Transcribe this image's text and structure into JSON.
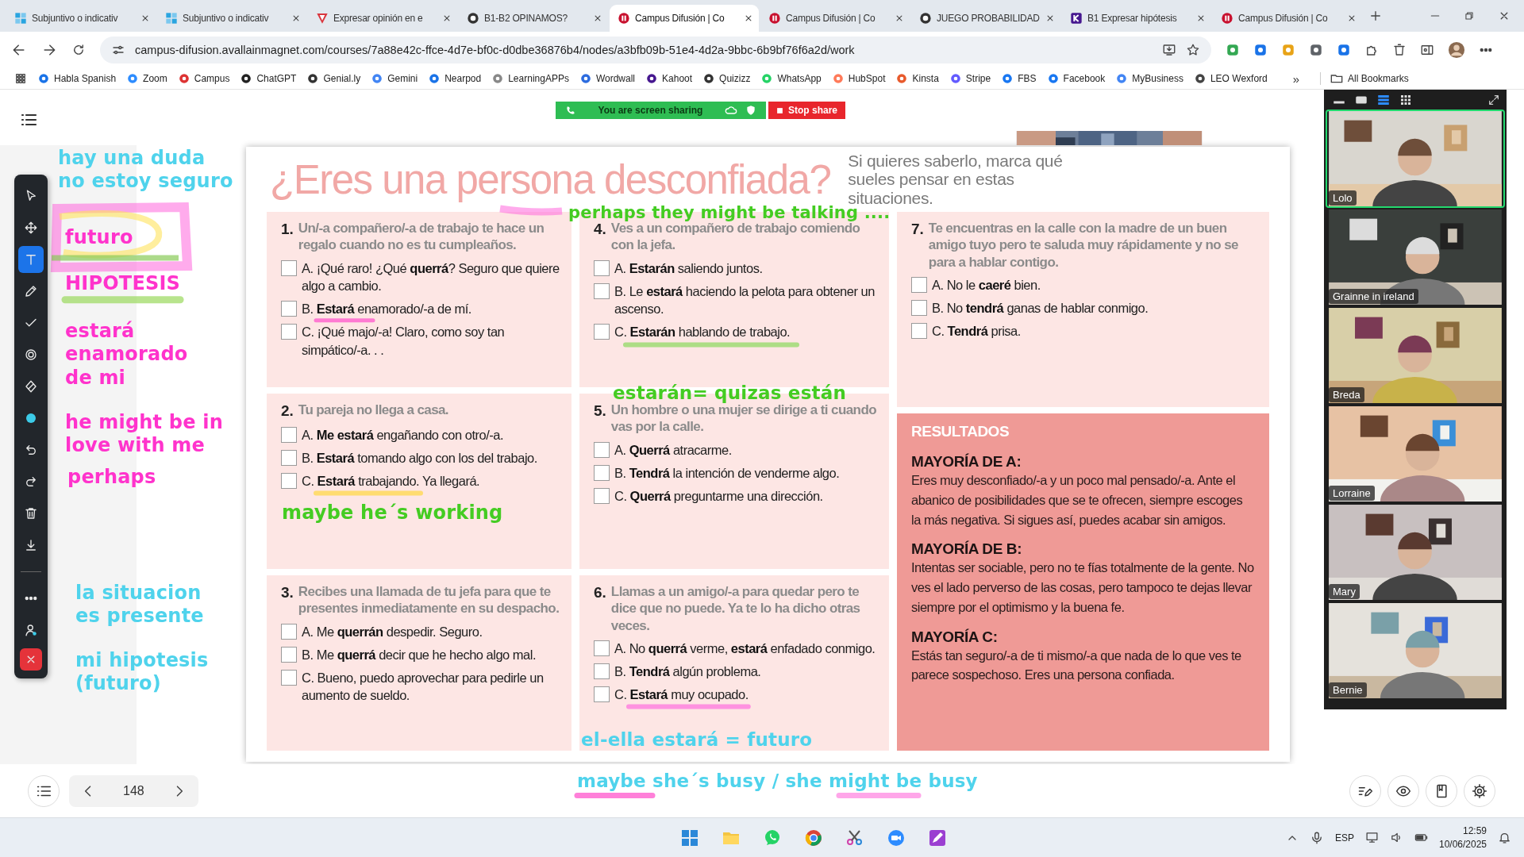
{
  "tabs": [
    {
      "title": "Subjuntivo o indicativ",
      "selected": false
    },
    {
      "title": "Subjuntivo o indicativ",
      "selected": false
    },
    {
      "title": "Expresar opinión en e",
      "selected": false
    },
    {
      "title": "B1-B2 OPINAMOS?",
      "selected": false
    },
    {
      "title": "Campus Difusión | Co",
      "selected": true
    },
    {
      "title": "Campus Difusión | Co",
      "selected": false
    },
    {
      "title": "JUEGO PROBABILIDAD",
      "selected": false
    },
    {
      "title": "B1 Expresar hipótesis",
      "selected": false
    },
    {
      "title": "Campus Difusión | Co",
      "selected": false
    }
  ],
  "address": {
    "url": "campus-difusion.avallainmagnet.com/courses/7a88e42c-ffce-4d7e-bf0c-d0dbe36876b4/nodes/a3bfb09b-51e4-4d2a-9bbc-6b9bf76f6a2d/work"
  },
  "bookmarks": [
    "Habla Spanish",
    "Zoom",
    "Campus",
    "ChatGPT",
    "Genial.ly",
    "Gemini",
    "Nearpod",
    "LearningAPPs",
    "Wordwall",
    "Kahoot",
    "Quizizz",
    "WhatsApp",
    "HubSpot",
    "Kinsta",
    "Stripe",
    "FBS",
    "Facebook",
    "MyBusiness",
    "LEO Wexford"
  ],
  "bookmarks_more": "»",
  "all_bookmarks": "All Bookmarks",
  "share_banner": {
    "status": "You are screen sharing",
    "stop": "Stop share"
  },
  "tools": [
    {
      "kind": "pointer",
      "selected": false
    },
    {
      "kind": "move",
      "selected": false
    },
    {
      "kind": "text",
      "selected": true
    },
    {
      "kind": "pencil",
      "selected": false
    },
    {
      "kind": "check",
      "selected": false
    },
    {
      "kind": "target",
      "selected": false
    },
    {
      "kind": "eraser",
      "selected": false
    },
    {
      "kind": "color",
      "selected": false
    },
    {
      "kind": "undo",
      "selected": false
    },
    {
      "kind": "redo",
      "selected": false
    },
    {
      "kind": "trash",
      "selected": false
    },
    {
      "kind": "download",
      "selected": false
    },
    {
      "kind": "more",
      "selected": false
    },
    {
      "kind": "person",
      "selected": false
    },
    {
      "kind": "close",
      "selected": false
    }
  ],
  "document": {
    "title": "¿Eres una persona desconfiada?",
    "intro": "Si quieres saberlo, marca qué sueles pensar en estas situaciones.",
    "questions": [
      {
        "number": "1.",
        "prompt": "Un/-a compañero/-a de trabajo te hace un regalo cuando no es tu cumpleaños.",
        "options": [
          {
            "text": "A. ¡Qué raro! ¿Qué **querrá**? Seguro que quiere algo a cambio.",
            "checked": false
          },
          {
            "text": "B. **Estará** enamorado/-a de mí.",
            "checked": false
          },
          {
            "text": "C. ¡Qué majo/-a! Claro, como soy tan simpático/-a. . .",
            "checked": false
          }
        ]
      },
      {
        "number": "2.",
        "prompt": "Tu pareja no llega a casa.",
        "options": [
          {
            "text": "A. **Me estará** engañando con otro/-a.",
            "checked": false
          },
          {
            "text": "B. **Estará** tomando algo con los del trabajo.",
            "checked": false
          },
          {
            "text": "C. **Estará** trabajando. Ya llegará.",
            "checked": false
          }
        ]
      },
      {
        "number": "3.",
        "prompt": "Recibes una llamada de tu jefa para que te presentes inmediatamente en su despacho.",
        "options": [
          {
            "text": "A. Me **querrán** despedir. Seguro.",
            "checked": false
          },
          {
            "text": "B. Me **querrá** decir que he hecho algo mal.",
            "checked": false
          },
          {
            "text": "C. Bueno, puedo aprovechar para pedirle un aumento de sueldo.",
            "checked": false
          }
        ]
      },
      {
        "number": "4.",
        "prompt": "Ves a un compañero de trabajo comiendo con la jefa.",
        "options": [
          {
            "text": "A. **Estarán** saliendo juntos.",
            "checked": false
          },
          {
            "text": "B. Le **estará** haciendo la pelota para obtener un ascenso.",
            "checked": false
          },
          {
            "text": "C. **Estarán** hablando de trabajo.",
            "checked": false
          }
        ]
      },
      {
        "number": "5.",
        "prompt": "Un hombre o una mujer se dirige a ti cuando vas por la calle.",
        "options": [
          {
            "text": "A. **Querrá** atracarme.",
            "checked": false
          },
          {
            "text": "B. **Tendrá** la intención de venderme algo.",
            "checked": false
          },
          {
            "text": "C. **Querrá** preguntarme una dirección.",
            "checked": false
          }
        ]
      },
      {
        "number": "6.",
        "prompt": "Llamas a un amigo/-a para quedar pero te dice que no puede. Ya te lo ha dicho otras veces.",
        "options": [
          {
            "text": "A. No **querrá** verme, **estará** enfadado conmigo.",
            "checked": false
          },
          {
            "text": "B. **Tendrá** algún problema.",
            "checked": false
          },
          {
            "text": "C. **Estará** muy ocupado.",
            "checked": false
          }
        ]
      },
      {
        "number": "7.",
        "prompt": "Te encuentras en la calle con la madre de un buen amigo tuyo pero te saluda muy rápidamente y no se para a hablar contigo.",
        "options": [
          {
            "text": "A. No le **caeré** bien.",
            "checked": false
          },
          {
            "text": "B. No **tendrá** ganas de hablar conmigo.",
            "checked": false
          },
          {
            "text": "C. **Tendrá** prisa.",
            "checked": false
          }
        ]
      }
    ],
    "results": {
      "heading": "RESULTADOS",
      "groups": [
        {
          "heading": "MAYORÍA DE A:",
          "text": "Eres muy desconfiado/-a y un poco mal pensado/-a. Ante el abanico de posibilidades que se te ofrecen, siempre escoges la más negativa. Si sigues así, puedes acabar sin amigos."
        },
        {
          "heading": "MAYORÍA DE B:",
          "text": "Intentas ser sociable, pero no te fías totalmente de la gente. No ves el lado perverso de las cosas, pero tampoco te dejas llevar siempre por el optimismo y la buena fe."
        },
        {
          "heading": "MAYORÍA C:",
          "text": "Estás tan seguro/-a de ti mismo/-a que nada de lo que ves te parece sospechoso. Eres una persona confiada."
        }
      ]
    }
  },
  "annotations": [
    {
      "text": "hay una duda\nno estoy seguro",
      "color": "#4fd3ec"
    },
    {
      "text": "futuro",
      "color": "#ff33cc"
    },
    {
      "text": "HIPOTESIS",
      "color": "#ff33cc"
    },
    {
      "text": "estará\nenamorado\nde mi",
      "color": "#ff33cc"
    },
    {
      "text": "he might be in\nlove with me",
      "color": "#ff33cc"
    },
    {
      "text": "perhaps",
      "color": "#ff33cc"
    },
    {
      "text": "maybe he´s working",
      "color": "#44cc22"
    },
    {
      "text": "la situacion\nes presente",
      "color": "#4fd3ec"
    },
    {
      "text": "mi hipotesis\n(futuro)",
      "color": "#4fd3ec"
    },
    {
      "text": "perhaps they might be talking ....",
      "color": "#44cc22"
    },
    {
      "text": "estarán= quizas están",
      "color": "#44cc22"
    },
    {
      "text": "el-ella estará = futuro",
      "color": "#4fd3ec"
    },
    {
      "text": "maybe she´s busy / she might be busy",
      "color": "#4fd3ec"
    }
  ],
  "pager": {
    "page": "148"
  },
  "video": [
    {
      "name": "Lolo",
      "speaking": true
    },
    {
      "name": "Grainne in ireland",
      "speaking": false
    },
    {
      "name": "Breda",
      "speaking": false
    },
    {
      "name": "Lorraine",
      "speaking": false
    },
    {
      "name": "Mary",
      "speaking": false
    },
    {
      "name": "Bernie",
      "speaking": false
    }
  ],
  "taskbar": {
    "language": "ESP",
    "time": "12:59",
    "date": "10/06/2025"
  }
}
